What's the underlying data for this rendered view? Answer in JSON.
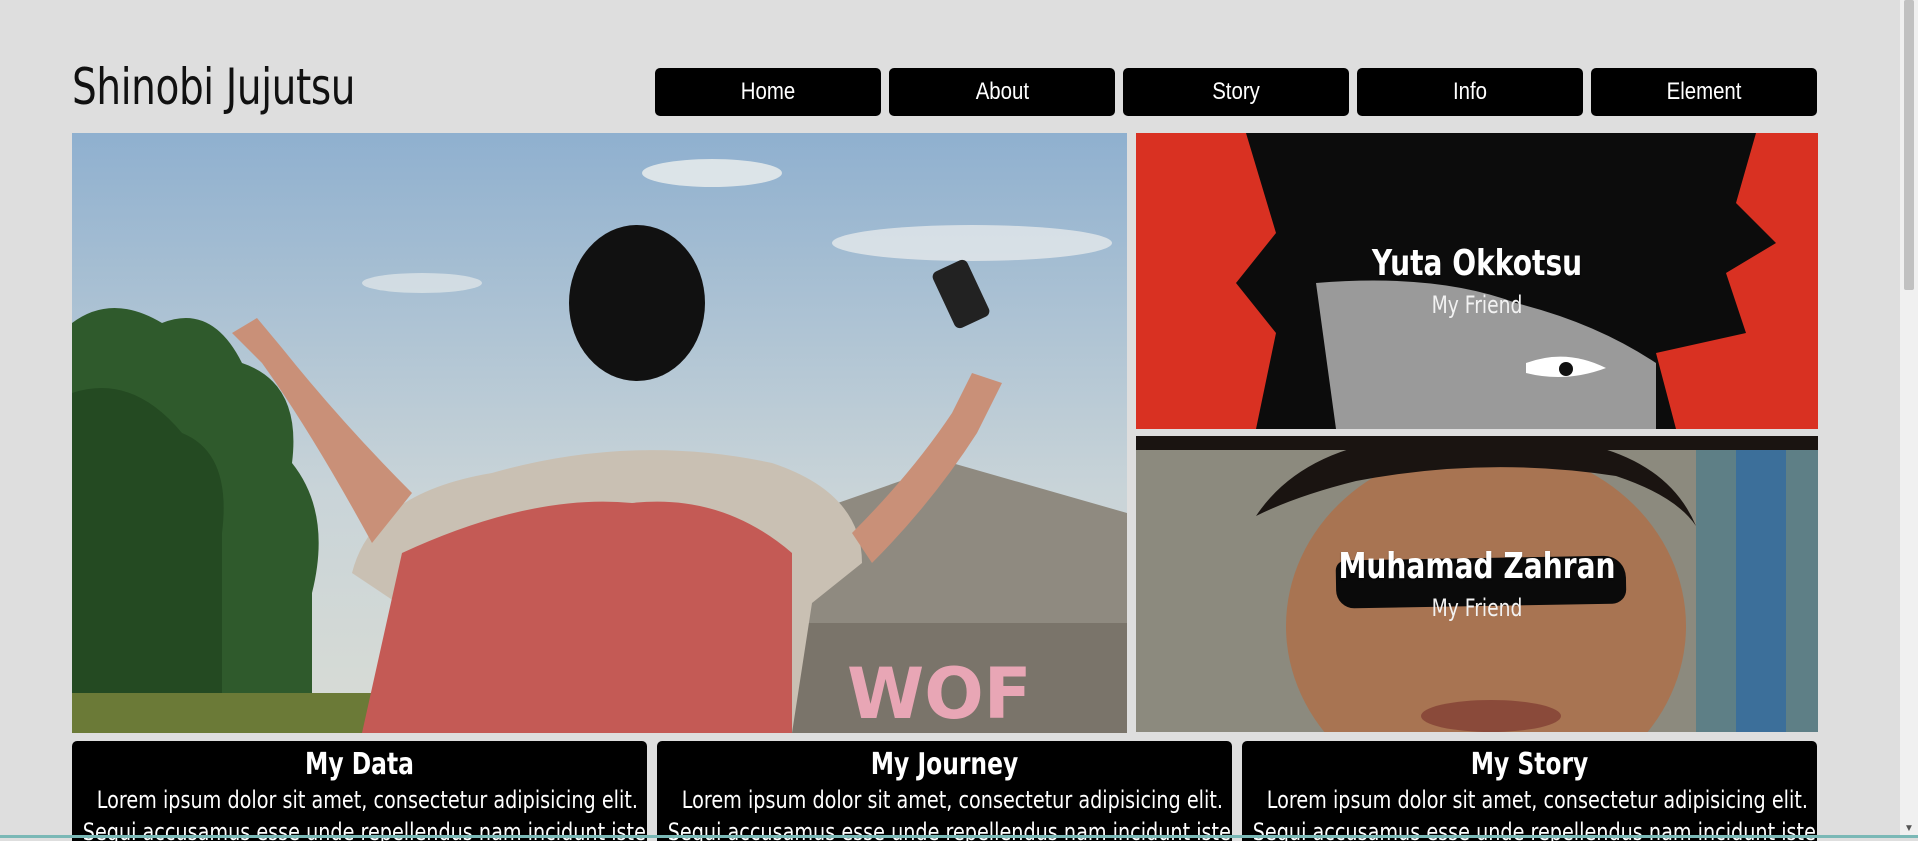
{
  "brand": {
    "title": "Shinobi Jujutsu"
  },
  "nav": {
    "items": [
      {
        "label": "Home"
      },
      {
        "label": "About"
      },
      {
        "label": "Story"
      },
      {
        "label": "Info"
      },
      {
        "label": "Element"
      }
    ]
  },
  "cards": [
    {
      "title": "Yuta Okkotsu",
      "subtitle": "My Friend"
    },
    {
      "title": "Muhamad Zahran",
      "subtitle": "My Friend"
    }
  ],
  "boxes": [
    {
      "title": "My Data",
      "text": "Lorem ipsum dolor sit amet, consectetur adipisicing elit. Sequi accusamus esse unde repellendus nam incidunt iste, commodi"
    },
    {
      "title": "My Journey",
      "text": "Lorem ipsum dolor sit amet, consectetur adipisicing elit. Sequi accusamus esse unde repellendus nam incidunt iste, commodi"
    },
    {
      "title": "My Story",
      "text": "Lorem ipsum dolor sit amet, consectetur adipisicing elit. Sequi accusamus esse unde repellendus nam incidunt iste, commodi"
    }
  ],
  "colors": {
    "background": "#dedede",
    "nav_button": "#000000",
    "card1_background": "#d93122"
  }
}
